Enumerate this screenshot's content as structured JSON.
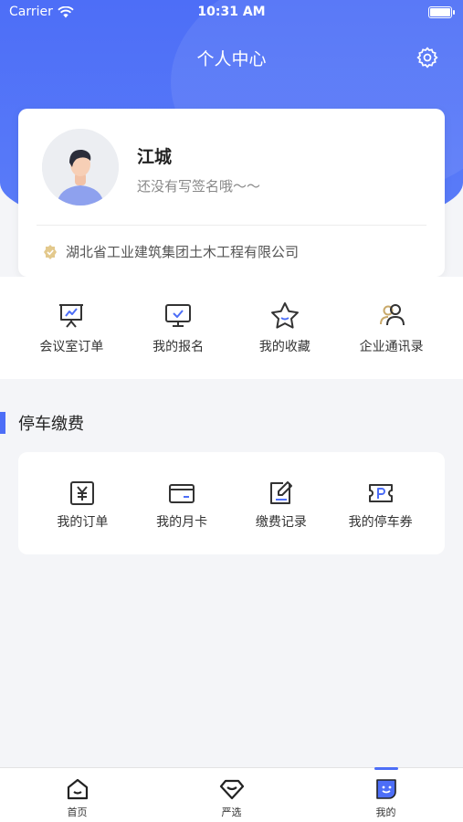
{
  "status_bar": {
    "carrier": "Carrier",
    "time": "10:31 AM"
  },
  "header": {
    "title": "个人中心"
  },
  "profile": {
    "name": "江城",
    "signature": "还没有写签名哦～～",
    "company": "湖北省工业建筑集团土木工程有限公司"
  },
  "quick_actions": [
    {
      "label": "会议室订单",
      "icon": "presentation-board-icon"
    },
    {
      "label": "我的报名",
      "icon": "monitor-check-icon"
    },
    {
      "label": "我的收藏",
      "icon": "star-icon"
    },
    {
      "label": "企业通讯录",
      "icon": "contacts-icon"
    }
  ],
  "parking": {
    "title": "停车缴费",
    "items": [
      {
        "label": "我的订单",
        "icon": "yen-order-icon"
      },
      {
        "label": "我的月卡",
        "icon": "card-icon"
      },
      {
        "label": "缴费记录",
        "icon": "edit-record-icon"
      },
      {
        "label": "我的停车券",
        "icon": "parking-ticket-icon"
      }
    ]
  },
  "tabs": [
    {
      "label": "首页",
      "icon": "home-icon"
    },
    {
      "label": "严选",
      "icon": "diamond-icon"
    },
    {
      "label": "我的",
      "icon": "face-icon"
    }
  ],
  "colors": {
    "primary": "#4d6ef7",
    "gold": "#c9a96a",
    "icon_dark": "#333333"
  }
}
